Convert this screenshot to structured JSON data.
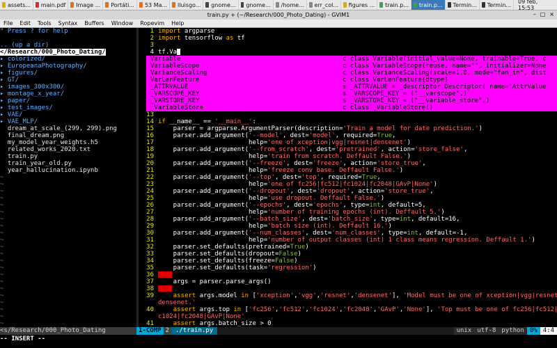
{
  "taskbar": {
    "tasks": [
      {
        "label": "assets...",
        "color": "#d8b000"
      },
      {
        "label": "main.pdf",
        "color": "#cc3333"
      },
      {
        "label": "Image ...",
        "color": "#e07020"
      },
      {
        "label": "Portáti...",
        "color": "#e07020"
      },
      {
        "label": "53 Ma...",
        "color": "#e07020"
      },
      {
        "label": "lluisgo...",
        "color": "#e07020"
      },
      {
        "label": "gnome...",
        "color": "#444444"
      },
      {
        "label": "gnome...",
        "color": "#444444"
      },
      {
        "label": "/home...",
        "color": "#888888"
      },
      {
        "label": "err_col...",
        "color": "#888888"
      },
      {
        "label": "figures ...",
        "color": "#d8b000"
      },
      {
        "label": "train.p...",
        "color": "#3aa060"
      },
      {
        "label": "train.p...",
        "color": "#3aa060",
        "active": true
      },
      {
        "label": "Termin...",
        "color": "#333333"
      },
      {
        "label": "Termin...",
        "color": "#333333"
      }
    ],
    "clock": "09 feb, 15:53"
  },
  "window": {
    "title": "train.py + (~/Research/000_Photo_Dating) - GVIM1",
    "buttons": [
      "–",
      "□",
      "×"
    ]
  },
  "menu": [
    "File",
    "Edit",
    "Tools",
    "Syntax",
    "Buffers",
    "Window",
    "Ropevim",
    "Help"
  ],
  "tree": {
    "help": "\" Press ? for help",
    "up": ".. (up a dir)",
    "root": "</Research/000_Photo_Dating/",
    "items": [
      {
        "text": "▸ colorized/",
        "type": "dir"
      },
      {
        "text": "▸ EuropeanaPhotography/",
        "type": "dir"
      },
      {
        "text": "▸ figures/",
        "type": "dir"
      },
      {
        "text": "▸ GT/",
        "type": "dir"
      },
      {
        "text": "▸ images_300x300/",
        "type": "dir"
      },
      {
        "text": "▸ montage_x_year/",
        "type": "dir"
      },
      {
        "text": "▸ paper/",
        "type": "dir"
      },
      {
        "text": "▸ test_images/",
        "type": "dir"
      },
      {
        "text": "▸ VAE/",
        "type": "dir"
      },
      {
        "text": "▸ VAE_MLP/",
        "type": "dir"
      },
      {
        "text": "  dream_at_scale_(299, 299).png",
        "type": "file"
      },
      {
        "text": "  final_dream.png",
        "type": "file"
      },
      {
        "text": "  my_model_year_weights.h5",
        "type": "file"
      },
      {
        "text": "  related_works_2020.txt",
        "type": "file"
      },
      {
        "text": "  train.py",
        "type": "file"
      },
      {
        "text": "  train_year_old.py",
        "type": "file"
      },
      {
        "text": "  year_hallucination.ipynb",
        "type": "file"
      }
    ]
  },
  "code": {
    "lines": [
      {
        "n": "1",
        "html": "<span class='kw'>import</span> argparse"
      },
      {
        "n": "2",
        "html": "<span class='kw'>import</span> tensorflow <span class='kw'>as</span> tf"
      },
      {
        "n": "3",
        "html": ""
      },
      {
        "n": "4",
        "html": "tf.Va<span class='cursor'></span>",
        "cur": true
      },
      {
        "n": "5",
        "html": ""
      },
      {
        "n": "6",
        "html": ""
      },
      {
        "n": "7",
        "html": "<span class='kw'>de</span>"
      },
      {
        "n": "8",
        "html": ""
      },
      {
        "n": "9",
        "html": ""
      },
      {
        "n": "10",
        "html": "  re"
      },
      {
        "n": "11",
        "html": ""
      },
      {
        "n": "12",
        "html": ""
      },
      {
        "n": "13",
        "html": ""
      },
      {
        "n": "14",
        "html": "<span class='kw'>if</span> __name__ == <span class='str'>'__main__'</span>:"
      },
      {
        "n": "15",
        "html": "    parser = argparse.ArgumentParser(description=<span class='str'>'Train a model for date prediction.'</span>)"
      },
      {
        "n": "16",
        "html": "    parser.add_argument(<span class='str'>'--model'</span>, dest=<span class='str'>'model'</span>, required=<span class='const'>True</span>,"
      },
      {
        "n": "17",
        "html": "                        help=<span class='str'>'one of xception|vgg|resnet|densenet'</span>)"
      },
      {
        "n": "18",
        "html": "    parser.add_argument(<span class='str'>'--from_scratch'</span>, dest=<span class='str'>'pretrained'</span>, action=<span class='str'>'store_false'</span>,"
      },
      {
        "n": "19",
        "html": "                        help=<span class='str'>'train from scratch. Deffault False.'</span>)"
      },
      {
        "n": "20",
        "html": "    parser.add_argument(<span class='str'>'--freeze'</span>, dest=<span class='str'>'freeze'</span>, action=<span class='str'>'store_true'</span>,"
      },
      {
        "n": "21",
        "html": "                        help=<span class='str'>'freeze conv base. Deffault False.'</span>)"
      },
      {
        "n": "22",
        "html": "    parser.add_argument(<span class='str'>'--top'</span>, dest=<span class='str'>'top'</span>, required=<span class='const'>True</span>,"
      },
      {
        "n": "23",
        "html": "                        help=<span class='str'>'one of fc256|fc512|fc1024|fc2048|GAvP|None'</span>)"
      },
      {
        "n": "24",
        "html": "    parser.add_argument(<span class='str'>'--dropout'</span>, dest=<span class='str'>'dropout'</span>, action=<span class='str'>'store_true'</span>,"
      },
      {
        "n": "25",
        "html": "                        help=<span class='str'>'use dropout. Deffault False.'</span>)"
      },
      {
        "n": "26",
        "html": "    parser.add_argument(<span class='str'>'--epochs'</span>, dest=<span class='str'>'epochs'</span>, type=<span class='const'>int</span>, default=5,"
      },
      {
        "n": "27",
        "html": "                        help=<span class='str'>'number of training epochs (int). Deffault 5.'</span>)"
      },
      {
        "n": "28",
        "html": "    parser.add_argument(<span class='str'>'--batch_size'</span>, dest=<span class='str'>'batch_size'</span>, type=<span class='const'>int</span>, default=16,"
      },
      {
        "n": "29",
        "html": "                        help=<span class='str'>'batch size (int). Deffault 16.'</span>)"
      },
      {
        "n": "30",
        "html": "    parser.add_argument(<span class='str'>'--num_classes'</span>, dest=<span class='str'>'num_classes'</span>, type=<span class='const'>int</span>, default=-1,"
      },
      {
        "n": "31",
        "html": "                        help=<span class='str'>'number of output classes (int) 1 class means regression. Deffault 1.'</span>)"
      },
      {
        "n": "32",
        "html": "    parser.set_defaults(pretrained=<span class='const'>True</span>)"
      },
      {
        "n": "33",
        "html": "    parser.set_defaults(dropout=<span class='const'>False</span>)"
      },
      {
        "n": "34",
        "html": "    parser.set_defaults(freeze=<span class='const'>False</span>)"
      },
      {
        "n": "35",
        "html": "    parser.set_defaults(task=<span class='str'>'regression'</span>)"
      },
      {
        "n": "36",
        "html": "<span class='redbox'></span>"
      },
      {
        "n": "37",
        "html": "    args = parser.parse_args()"
      },
      {
        "n": "38",
        "html": "<span class='redbox'></span>"
      },
      {
        "n": "39",
        "html": "    <span class='kw'>assert</span> args.model <span class='kw'>in</span> [<span class='str'>'xception'</span>,<span class='str'>'vgg'</span>,<span class='str'>'resnet'</span>,<span class='str'>'densenet'</span>], <span class='str'>'Model must be one of xception|vgg|resnet|</span>"
      },
      {
        "n": "",
        "html": "<span class='str'>densenet.'</span>"
      },
      {
        "n": "40",
        "html": "    <span class='kw'>assert</span> args.top <span class='kw'>in</span> [<span class='str'>'fc256'</span>,<span class='str'>'fc512'</span>,<span class='str'>'fc1024'</span>,<span class='str'>'fc2048'</span>,<span class='str'>'GAvP'</span>,<span class='str'>'None'</span>], <span class='str'>'Top must be one of fc256|fc512|f</span>"
      },
      {
        "n": "",
        "html": "<span class='str'>c1024|fc2048|GAvP|None'</span>"
      },
      {
        "n": "41",
        "html": "    <span class='kw'>assert</span> args.batch_size > 0"
      }
    ]
  },
  "completion": [
    {
      "name": "Variable",
      "desc": "c class Variable(initial_value=None, trainable=True, c"
    },
    {
      "name": "VariableScope",
      "desc": "c class VariableScope(reuse, name=\"\", initializer=None"
    },
    {
      "name": "VarianceScaling",
      "desc": "c class VarianceScaling(scale=1.0, mode=\"fan_in\", dist"
    },
    {
      "name": "VarLenFeature",
      "desc": "c class VarLenFeature(dtype)"
    },
    {
      "name": "_ATTRVALUE",
      "desc": "s _ATTRVALUE = _descriptor.Descriptor( name='AttrValue"
    },
    {
      "name": "_VARSCOPE_KEY",
      "desc": "s _VARSCOPE_KEY = (\"__varscope\",)"
    },
    {
      "name": "_VARSTORE_KEY",
      "desc": "s _VARSTORE_KEY = (\"__variable_store\",)"
    },
    {
      "name": "_VariableStore",
      "desc": "c class _VariableStore()"
    }
  ],
  "status": {
    "left": "<s/Research/000_Photo_Dating",
    "mode": "1-COMP",
    "buf": "2",
    "file": "./train.py",
    "encoding": "unix",
    "charset": "utf-8",
    "filetype": "python",
    "percent": "0%",
    "position": "4:4"
  },
  "cmdline": "-- INSERT --"
}
